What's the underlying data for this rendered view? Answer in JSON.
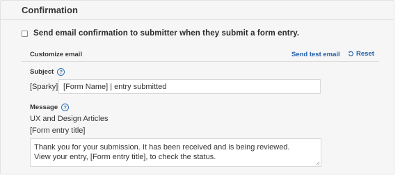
{
  "section": {
    "title": "Confirmation"
  },
  "confirmation": {
    "checked": false,
    "label": "Send email confirmation to submitter when they submit a form entry."
  },
  "email_header": {
    "title": "Customize email",
    "send_test_label": "Send test email",
    "reset_label": "Reset",
    "reset_icon": "undo-icon"
  },
  "subject": {
    "label": "Subject",
    "help_icon": "help-icon",
    "help_glyph": "?",
    "prefix": "[Sparky]",
    "value": "[Form Name] | entry submitted"
  },
  "message": {
    "label": "Message",
    "help_icon": "help-icon",
    "help_glyph": "?",
    "header_line1": "UX and Design Articles",
    "header_line2": "[Form entry title]",
    "body_line1": "Thank you for your submission. It has been received and is being reviewed.",
    "body_line2": "View your entry, [Form entry title], to check the status."
  },
  "colors": {
    "link": "#1f5ea8",
    "panel_bg": "#f6f6f6"
  }
}
